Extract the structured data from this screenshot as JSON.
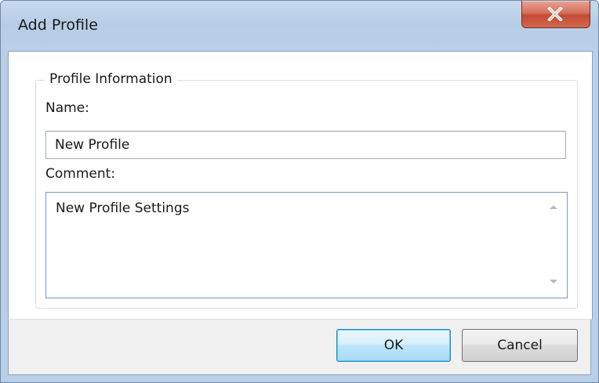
{
  "window": {
    "title": "Add Profile"
  },
  "group": {
    "legend": "Profile Information",
    "name_label": "Name:",
    "name_value": "New Profile",
    "comment_label": "Comment:",
    "comment_value": "New Profile Settings"
  },
  "buttons": {
    "ok": "OK",
    "cancel": "Cancel"
  },
  "icons": {
    "close": "close-icon",
    "scroll_up": "scroll-up-arrow-icon",
    "scroll_down": "scroll-down-arrow-icon"
  },
  "colors": {
    "close_button": "#c44a33",
    "ok_button_border": "#3c7fb1",
    "title_bar": "#b9cfe7"
  }
}
